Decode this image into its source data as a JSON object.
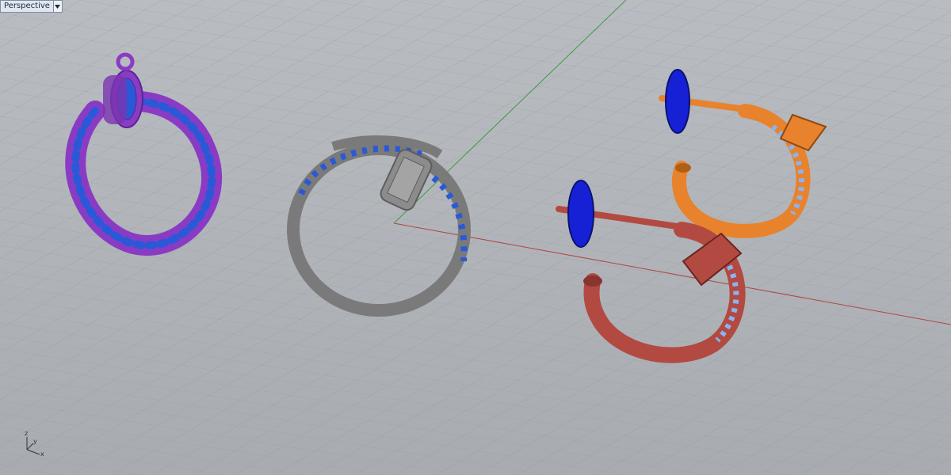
{
  "viewport": {
    "name": "Perspective",
    "axes": {
      "x": "x",
      "y": "y",
      "z": "z"
    }
  },
  "colors": {
    "background": "#aeb2b7",
    "grid": "#8f959b",
    "x_axis": "#b0473f",
    "y_axis": "#3f9a3f",
    "gem": "#2a59d8",
    "purple_ring": "#8a3bc4",
    "grey_ring": "#7a7a7a",
    "orange_earring": "#e8822c",
    "red_earring": "#b24a42",
    "back_disc": "#1621d6"
  },
  "objects": [
    {
      "label": "purple-pendant-ring"
    },
    {
      "label": "grey-nail-ring"
    },
    {
      "label": "orange-hoop-earring"
    },
    {
      "label": "red-hoop-earring"
    }
  ]
}
